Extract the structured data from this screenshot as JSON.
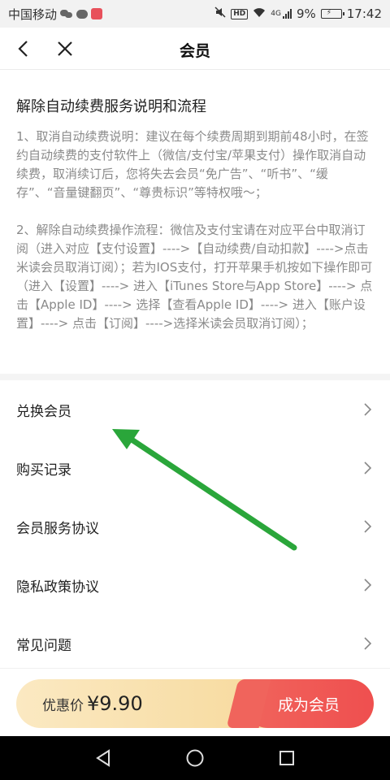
{
  "status_bar": {
    "carrier": "中国移动",
    "network": "4G",
    "battery": "9%",
    "time": "17:42"
  },
  "header": {
    "title": "会员",
    "back_icon": "chevron-left-icon",
    "close_icon": "close-icon"
  },
  "notice": {
    "title": "解除自动续费服务说明和流程",
    "para1": "1、取消自动续费说明：建议在每个续费周期到期前48小时，在签约自动续费的支付软件上（微信/支付宝/苹果支付）操作取消自动续费，取消续订后，您将失去会员“免广告”、“听书”、“缓存”、“音量键翻页”、“尊贵标识”等特权哦～；",
    "para2": "2、解除自动续费操作流程：微信及支付宝请在对应平台中取消订阅（进入对应【支付设置】---->【自动续费/自动扣款】---->点击米读会员取消订阅）；若为IOS支付，打开苹果手机按如下操作即可（进入【设置】----> 进入【iTunes Store与App Store】----> 点击【Apple ID】----> 选择【查看Apple ID】----> 进入【账户设置】----> 点击【订阅】---->选择米读会员取消订阅）；"
  },
  "menu": {
    "items": [
      {
        "label": "兑换会员"
      },
      {
        "label": "购买记录"
      },
      {
        "label": "会员服务协议"
      },
      {
        "label": "隐私政策协议"
      },
      {
        "label": "常见问题"
      }
    ]
  },
  "purchase": {
    "price_label": "优惠价",
    "price_value": "¥9.90",
    "button_label": "成为会员"
  },
  "colors": {
    "annotation_arrow": "#2aa63a",
    "accent_red": "#ef4f4f",
    "gold": "#f5d48f"
  }
}
